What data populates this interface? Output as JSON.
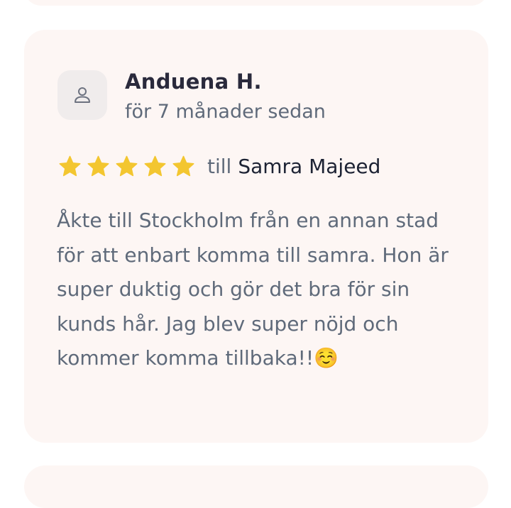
{
  "review": {
    "reviewer_name": "Anduena H.",
    "date": "för 7 månader sedan",
    "rating": 5,
    "rating_max": 5,
    "to_label": "till",
    "stylist_name": "Samra Majeed",
    "text": "Åkte till Stockholm från en annan stad för att enbart komma till samra. Hon är super duktig och gör det bra för sin kunds hår. Jag blev super nöjd och kommer komma tillbaka!!☺️"
  },
  "colors": {
    "card_background": "#fdf6f4",
    "star": "#f3c630",
    "avatar_background": "#f0ecec"
  },
  "icons": {
    "avatar": "user-icon",
    "star": "star-icon"
  }
}
